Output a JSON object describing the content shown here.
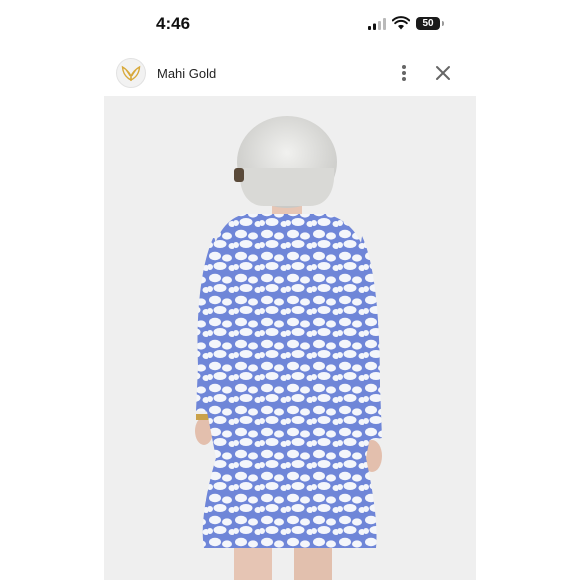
{
  "status_bar": {
    "time": "4:46",
    "battery": "50"
  },
  "header": {
    "brand": "Mahi Gold",
    "logo_icon": "wings-logo-icon",
    "more_icon": "more-vertical-icon",
    "close_icon": "close-icon"
  },
  "photo": {
    "subject": "woman with white bob hair in blue and white leopard print three-quarter sleeve dress, back view"
  },
  "colors": {
    "dress_blue": "#6f86d8",
    "dress_white": "#f4f6fb",
    "background": "#efefef",
    "logo_gold": "#d8a93a"
  }
}
